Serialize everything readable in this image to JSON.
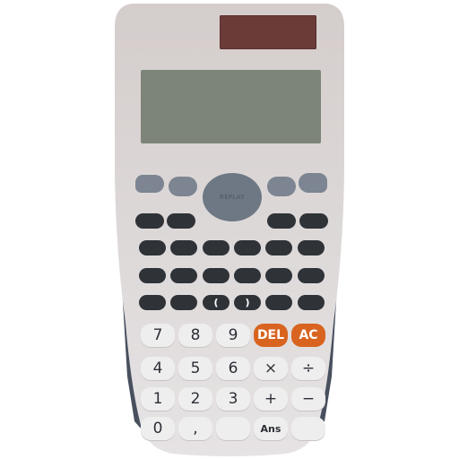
{
  "calculator": {
    "replay_label": "REPLAY",
    "keys": {
      "open_paren": "(",
      "close_paren": ")",
      "n7": "7",
      "n8": "8",
      "n9": "9",
      "del": "DEL",
      "ac": "AC",
      "n4": "4",
      "n5": "5",
      "n6": "6",
      "multiply": "×",
      "divide": "÷",
      "n1": "1",
      "n2": "2",
      "n3": "3",
      "plus": "+",
      "minus": "−",
      "n0": "0",
      "comma": ",",
      "ans": "Ans"
    },
    "colors": {
      "body": "#dcd7d7",
      "side": "#48505f",
      "dark_key": "#2f3338",
      "light_key": "#efeeef",
      "orange_key": "#d86420",
      "solar": "#6b3b38",
      "display": "#7d8578",
      "function_key": "#7c8591"
    }
  }
}
